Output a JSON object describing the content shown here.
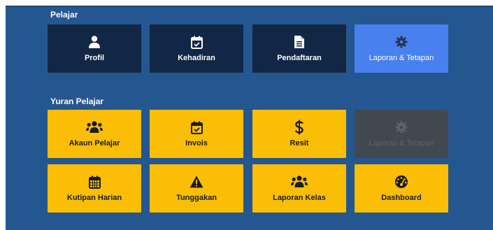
{
  "sections": [
    {
      "title": "Pelajar",
      "tiles": [
        {
          "label": "Profil",
          "icon": "user-icon"
        },
        {
          "label": "Kehadiran",
          "icon": "calendar-check-icon"
        },
        {
          "label": "Pendaftaran",
          "icon": "document-icon"
        },
        {
          "label": "Laporan & Tetapan",
          "icon": "gear-icon",
          "state": "active"
        }
      ]
    },
    {
      "title": "Yuran Pelajar",
      "tiles": [
        {
          "label": "Akaun Pelajar",
          "icon": "users-icon"
        },
        {
          "label": "Invois",
          "icon": "calendar-check-icon"
        },
        {
          "label": "Resit",
          "icon": "dollar-icon"
        },
        {
          "label": "Laporan & Tetapan",
          "icon": "gear-icon",
          "state": "disabled"
        },
        {
          "label": "Kutipan Harian",
          "icon": "calendar-icon"
        },
        {
          "label": "Tunggakan",
          "icon": "warning-icon"
        },
        {
          "label": "Laporan Kelas",
          "icon": "users-icon"
        },
        {
          "label": "Dashboard",
          "icon": "dashboard-icon"
        }
      ]
    }
  ],
  "colors": {
    "background": "#24568f",
    "tile_dark": "#122745",
    "tile_active": "#4880f0",
    "tile_yellow": "#fbbe06",
    "tile_disabled": "#414850"
  }
}
